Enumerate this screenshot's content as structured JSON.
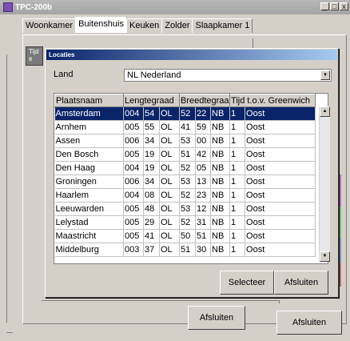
{
  "window": {
    "title": "TPC-200b",
    "buttons": [
      "_",
      "□",
      "x"
    ]
  },
  "tabs": [
    "Woonkamer",
    "Buitenshuis",
    "Keuken",
    "Zolder",
    "Slaapkamer 1"
  ],
  "groupbox": {
    "label": "Tijd e"
  },
  "dialog": {
    "title": "Locaties",
    "land_label": "Land",
    "land_value": "NL  Nederland",
    "columns": [
      "Plaatsnaam",
      "Lengtegraad",
      "Breedtegraad",
      "Tijd t.o.v. Greenwich"
    ],
    "rows": [
      [
        "Amsterdam",
        "004",
        "54",
        "OL",
        "52",
        "22",
        "NB",
        "1",
        "Oost"
      ],
      [
        "Arnhem",
        "005",
        "55",
        "OL",
        "41",
        "59",
        "NB",
        "1",
        "Oost"
      ],
      [
        "Assen",
        "006",
        "34",
        "OL",
        "53",
        "00",
        "NB",
        "1",
        "Oost"
      ],
      [
        "Den Bosch",
        "005",
        "19",
        "OL",
        "51",
        "42",
        "NB",
        "1",
        "Oost"
      ],
      [
        "Den Haag",
        "004",
        "19",
        "OL",
        "52",
        "05",
        "NB",
        "1",
        "Oost"
      ],
      [
        "Groningen",
        "006",
        "34",
        "OL",
        "53",
        "13",
        "NB",
        "1",
        "Oost"
      ],
      [
        "Haarlem",
        "004",
        "08",
        "OL",
        "52",
        "23",
        "NB",
        "1",
        "Oost"
      ],
      [
        "Leeuwarden",
        "005",
        "48",
        "OL",
        "53",
        "12",
        "NB",
        "1",
        "Oost"
      ],
      [
        "Lelystad",
        "005",
        "29",
        "OL",
        "52",
        "31",
        "NB",
        "1",
        "Oost"
      ],
      [
        "Maastricht",
        "005",
        "41",
        "OL",
        "50",
        "51",
        "NB",
        "1",
        "Oost"
      ],
      [
        "Middelburg",
        "003",
        "37",
        "OL",
        "51",
        "30",
        "NB",
        "1",
        "Oost"
      ]
    ],
    "selected_row": 0,
    "select_button": "Selecteer",
    "close_button": "Afsluiten"
  },
  "bottom_buttons": {
    "afsluiten_1": "Afsluiten",
    "afsluiten_2": "Afsluiten"
  },
  "colors": {
    "selection": "#0a246a",
    "face": "#d4d0c8",
    "groupbox": "#7a7a7a"
  }
}
